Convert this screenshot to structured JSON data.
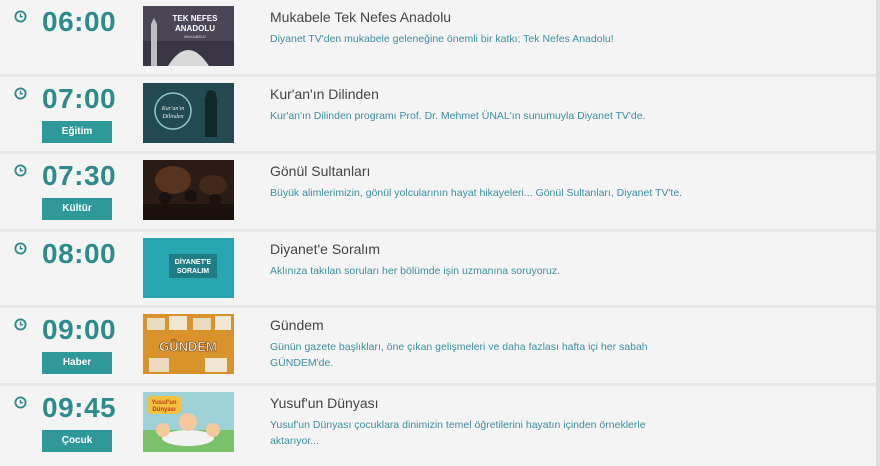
{
  "colors": {
    "time": "#2e8b8b",
    "badge": "#2f9898",
    "desc": "#3a8fa0",
    "title": "#444444"
  },
  "schedule": [
    {
      "time": "06:00",
      "category": "",
      "title": "Mukabele Tek Nefes Anadolu",
      "description": "Diyanet TV'den mukabele geleneğine önemli bir katkı; Tek Nefes Anadolu!",
      "thumb_text": [
        "TEK NEFES",
        "ANADOLU",
        "MUKABELE"
      ]
    },
    {
      "time": "07:00",
      "category": "Eğitim",
      "title": "Kur'an'ın Dilinden",
      "description": "Kur'an'ın Dilinden programı Prof. Dr. Mehmet ÜNAL'ın sunumuyla Diyanet TV'de.",
      "thumb_text": [
        "Kur'an'ın",
        "Dilinden"
      ]
    },
    {
      "time": "07:30",
      "category": "Kültür",
      "title": "Gönül Sultanları",
      "description": "Büyük alimlerimizin, gönül yolcularının hayat hikayeleri... Gönül Sultanları, Diyanet TV'te.",
      "thumb_text": []
    },
    {
      "time": "08:00",
      "category": "",
      "title": "Diyanet'e Soralım",
      "description": "Aklınıza takılan soruları her bölümde işin uzmanına soruyoruz.",
      "thumb_text": [
        "DİYANET'E",
        "SORALIM"
      ]
    },
    {
      "time": "09:00",
      "category": "Haber",
      "title": "Gündem",
      "description": "Günün gazete başlıkları, öne çıkan gelişmeleri ve daha fazlası hafta içi her sabah GÜNDEM'de.",
      "thumb_text": [
        "GÜNDEM"
      ]
    },
    {
      "time": "09:45",
      "category": "Çocuk",
      "title": "Yusuf'un Dünyası",
      "description": "Yusuf'un Dünyası çocuklara dinimizin temel öğretilerini hayatın içinden örneklerle aktarıyor...",
      "thumb_text": [
        "Yusuf'un",
        "Dünyası"
      ]
    }
  ]
}
